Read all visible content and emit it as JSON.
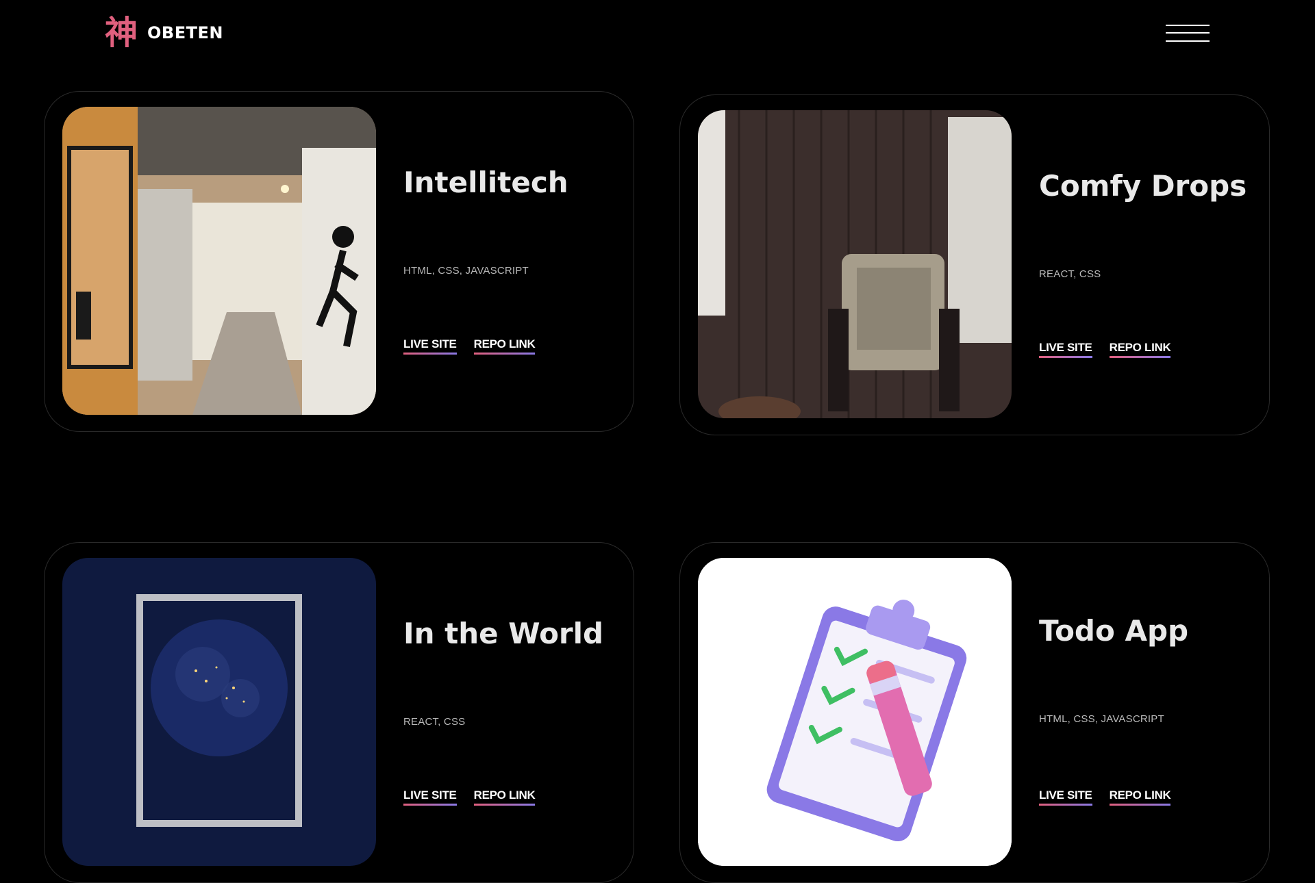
{
  "header": {
    "logo_glyph": "神",
    "logo_text": "OBETEN",
    "menu_icon": "hamburger-icon"
  },
  "projects": [
    {
      "title": "Intellitech",
      "tech": "HTML, CSS, JAVASCRIPT",
      "live_label": "LIVE SITE",
      "repo_label": "REPO LINK",
      "image": "office-hallway-image"
    },
    {
      "title": "Comfy Drops",
      "tech": "REACT, CSS",
      "live_label": "LIVE SITE",
      "repo_label": "REPO LINK",
      "image": "armchair-room-image"
    },
    {
      "title": "In the World",
      "tech": "REACT, CSS",
      "live_label": "LIVE SITE",
      "repo_label": "REPO LINK",
      "image": "earth-globe-image"
    },
    {
      "title": "Todo App",
      "tech": "HTML, CSS, JAVASCRIPT",
      "live_label": "LIVE SITE",
      "repo_label": "REPO LINK",
      "image": "clipboard-checklist-image"
    }
  ],
  "colors": {
    "accent_pink": "#e0607e",
    "accent_purple": "#8a79e6",
    "background": "#000000"
  }
}
